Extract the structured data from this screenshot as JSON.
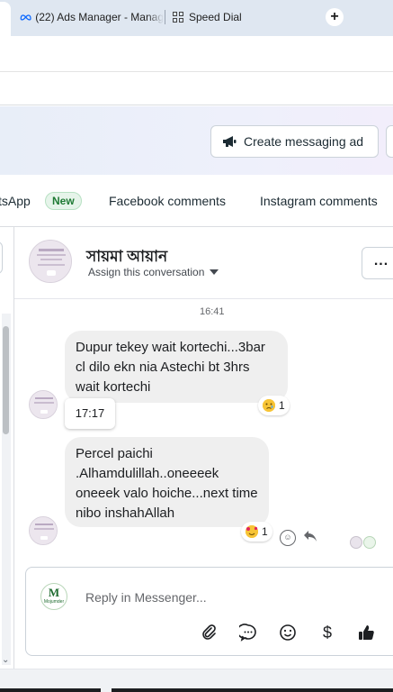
{
  "browser": {
    "tabs": [
      {
        "title": "(22) Ads Manager - Manag",
        "icon": "meta-icon"
      },
      {
        "title": "Speed Dial",
        "icon": "grid-icon"
      }
    ],
    "new_tab_icon": "+"
  },
  "header": {
    "create_button_label": "Create messaging ad",
    "create_button_icon": "megaphone-icon"
  },
  "channels": {
    "whatsapp_label": "tsApp",
    "whatsapp_badge": "New",
    "facebook_label": "Facebook comments",
    "instagram_label": "Instagram comments"
  },
  "conversation": {
    "contact_name": "সায়মা আয়ান",
    "assign_label": "Assign this conversation",
    "more_label": "..."
  },
  "messages": {
    "timestamp": "16:41",
    "items": [
      {
        "text": "Dupur tekey wait kortechi...3bar cl dilo ekn nia Astechi bt 3hrs wait kortechi",
        "reaction_count": "1",
        "reaction_emoji": "sad-face"
      },
      {
        "text": "Percel paichi .Alhamdulillah..oneeeek oneeek valo hoiche...next time nibo inshahAllah",
        "reaction_count": "1",
        "reaction_emoji": "smiling-face-with-hearts"
      }
    ],
    "hover_time": "17:17"
  },
  "composer": {
    "placeholder": "Reply in Messenger...",
    "page_logo_letter": "M",
    "page_logo_text": "Mojumder"
  },
  "colors": {
    "accent": "#1877f2",
    "bubble": "#efefef",
    "badge_green": "#1e7a34"
  }
}
